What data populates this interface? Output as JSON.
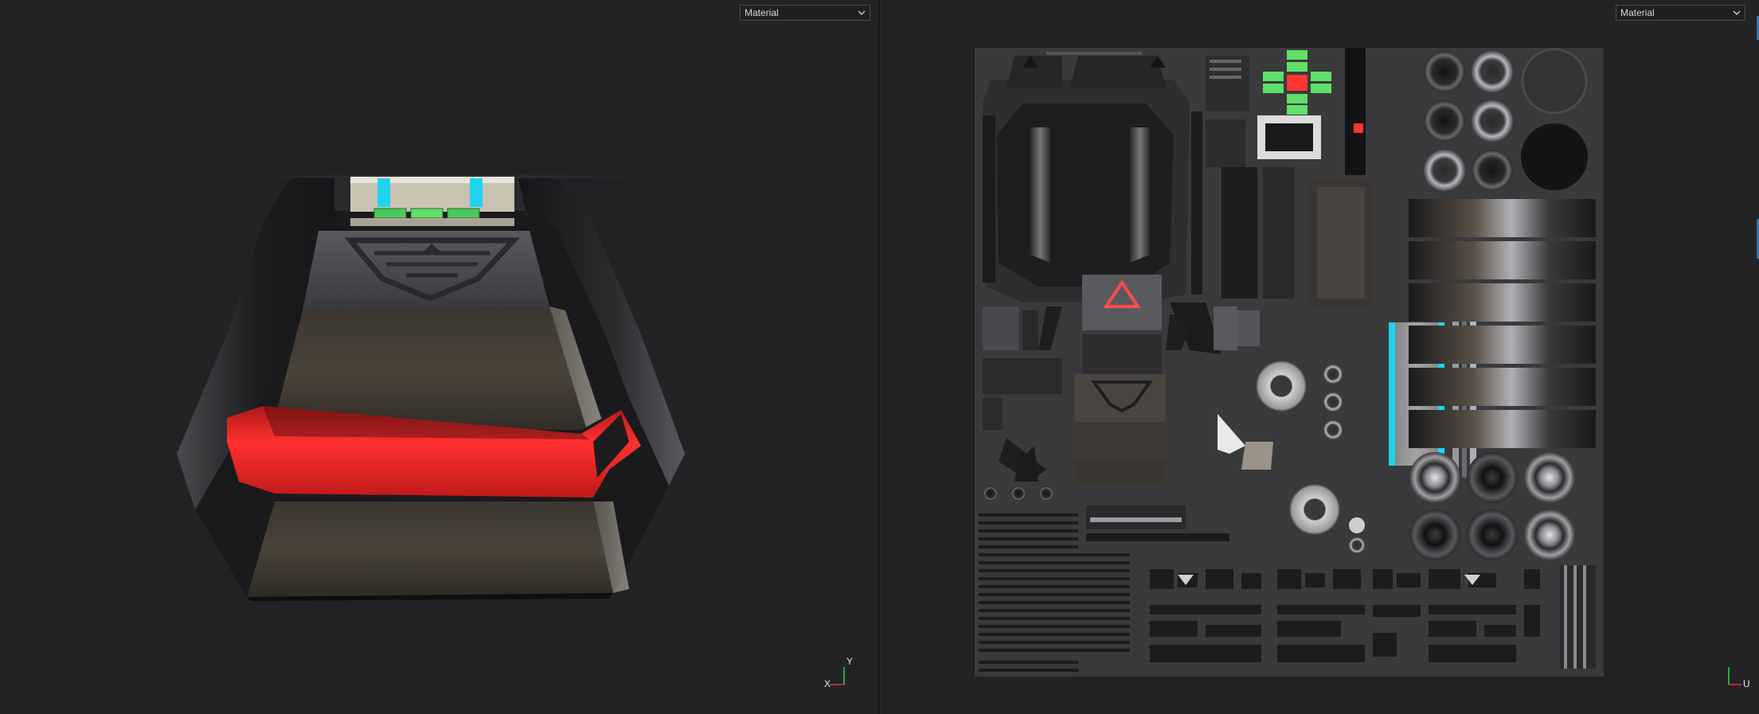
{
  "viewport3d": {
    "shading_dropdown": {
      "value": "Material",
      "icon": "chevron-down-icon"
    },
    "axis_gizmo": {
      "x_label": "X",
      "y_label": "Y"
    }
  },
  "viewport_uv": {
    "shading_dropdown": {
      "value": "Material",
      "icon": "chevron-down-icon"
    },
    "axis_gizmo": {
      "u_label": "U"
    }
  },
  "colors": {
    "background": "#232326",
    "emissive_red": "#ff2a2a",
    "emissive_cyan": "#20d4f0",
    "emissive_green": "#5ee06a",
    "axis_red": "#e03030",
    "axis_green": "#40d040"
  }
}
